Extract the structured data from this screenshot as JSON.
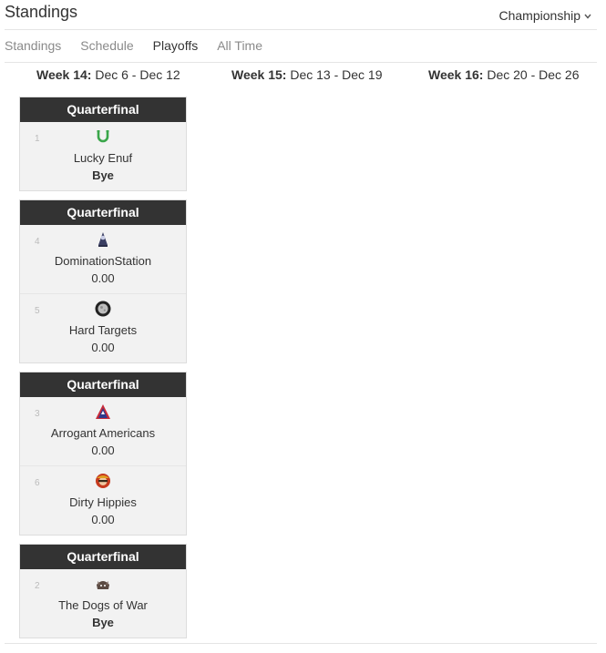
{
  "header": {
    "title": "Standings",
    "dropdown": "Championship",
    "dropdown_icon": "chevron-down-icon"
  },
  "tabs": [
    {
      "label": "Standings",
      "active": false
    },
    {
      "label": "Schedule",
      "active": false
    },
    {
      "label": "Playoffs",
      "active": true
    },
    {
      "label": "All Time",
      "active": false
    }
  ],
  "weeks": [
    {
      "label": "Week 14:",
      "dates": " Dec 6 - Dec 12"
    },
    {
      "label": "Week 15:",
      "dates": " Dec 13 - Dec 19"
    },
    {
      "label": "Week 16:",
      "dates": " Dec 20 - Dec 26"
    }
  ],
  "matchups": [
    {
      "round": "Quarterfinal",
      "teams": [
        {
          "seed": "1",
          "name": "Lucky Enuf",
          "score": "Bye",
          "logo": "horseshoe-logo"
        }
      ]
    },
    {
      "round": "Quarterfinal",
      "teams": [
        {
          "seed": "4",
          "name": "DominationStation",
          "score": "0.00",
          "logo": "hooded-figure-logo"
        },
        {
          "seed": "5",
          "name": "Hard Targets",
          "score": "0.00",
          "logo": "moon-logo"
        }
      ]
    },
    {
      "round": "Quarterfinal",
      "teams": [
        {
          "seed": "3",
          "name": "Arrogant Americans",
          "score": "0.00",
          "logo": "letter-a-logo"
        },
        {
          "seed": "6",
          "name": "Dirty Hippies",
          "score": "0.00",
          "logo": "hippie-logo"
        }
      ]
    },
    {
      "round": "Quarterfinal",
      "teams": [
        {
          "seed": "2",
          "name": "The Dogs of War",
          "score": "Bye",
          "logo": "war-dog-logo"
        }
      ]
    }
  ]
}
